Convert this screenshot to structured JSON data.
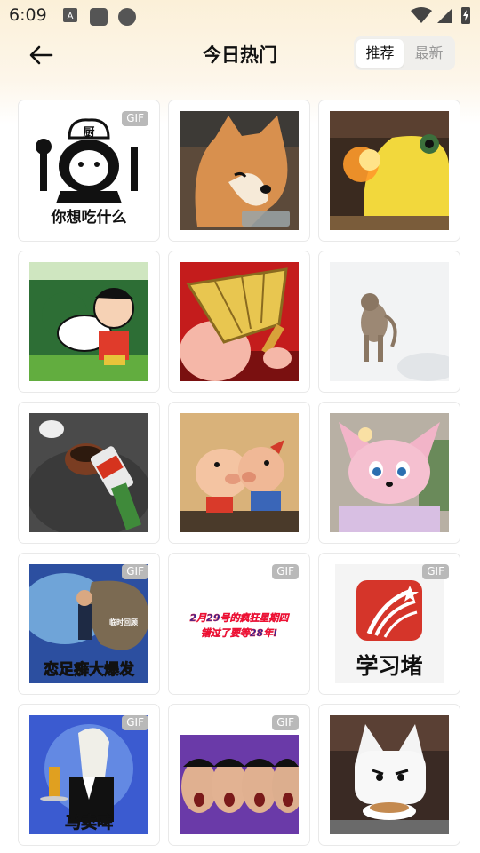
{
  "status_bar": {
    "time": "6:09"
  },
  "header": {
    "title": "今日热门",
    "tabs": {
      "recommended": "推荐",
      "latest": "最新"
    }
  },
  "badge": "GIF",
  "stickers": [
    {
      "name": "chef-panda-sticker",
      "caption": "你想吃什么",
      "hat_text": "厨",
      "gif": true
    },
    {
      "name": "shiba-dog-sticker",
      "caption": "",
      "gif": false
    },
    {
      "name": "pikachu-sticker",
      "caption": "",
      "gif": false
    },
    {
      "name": "crayon-shinchan-sticker",
      "caption": "",
      "gif": false
    },
    {
      "name": "pig-with-fan-sticker",
      "caption": "",
      "gif": false
    },
    {
      "name": "monkey-in-snow-sticker",
      "caption": "",
      "gif": false
    },
    {
      "name": "teapot-and-can-sticker",
      "caption": "",
      "gif": false
    },
    {
      "name": "two-pigs-hug-sticker",
      "caption": "",
      "gif": false
    },
    {
      "name": "pink-fox-sticker",
      "caption": "",
      "gif": false
    },
    {
      "name": "foot-fetish-sticker",
      "caption": "恋足癖大爆发",
      "gif": true
    },
    {
      "name": "date-text-sticker",
      "caption": "2月29号的疯狂星期四",
      "caption2": "错过了要等28年!",
      "gif": true
    },
    {
      "name": "xuexitong-logo-sticker",
      "caption": "学习堵",
      "gif": true
    },
    {
      "name": "horse-waiter-sticker",
      "caption": "马卖啤",
      "gif": true
    },
    {
      "name": "screaming-faces-sticker",
      "caption": "",
      "gif": true
    },
    {
      "name": "white-cat-sticker",
      "caption": "",
      "gif": false
    }
  ]
}
